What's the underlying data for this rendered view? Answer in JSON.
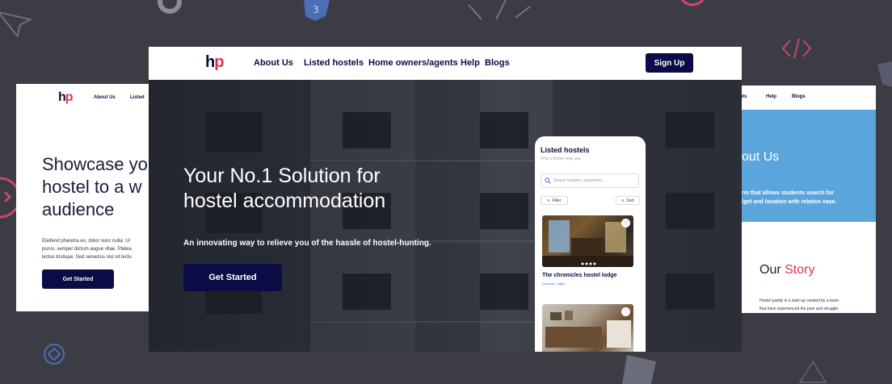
{
  "brand": {
    "logo_h": "h",
    "logo_p": "p"
  },
  "colors": {
    "navy": "#0b0b45",
    "red": "#e2304b",
    "blue_band": "#5aa6dc",
    "background": "#3c3c45"
  },
  "main": {
    "nav": {
      "links": [
        "About Us",
        "Listed hostels",
        "Home owners/agents",
        "Help",
        "Blogs"
      ],
      "signup": "Sign Up"
    },
    "hero": {
      "title_line1": "Your No.1 Solution for",
      "title_line2": "hostel accommodation",
      "subtitle": "An innovating way to relieve you of the hassle of hostel-hunting.",
      "cta": "Get Started"
    },
    "phone": {
      "title": "Listed hostels",
      "subtitle": "Find a hostel near you",
      "search_placeholder": "Search location, apartment...",
      "filter": "Filter",
      "sort": "Sort",
      "card_title": "The chronicles hostel lodge",
      "card_location": "Surulere, Lagos"
    }
  },
  "left_card": {
    "nav": [
      "About Us",
      "Listed"
    ],
    "title_line1": "Showcase yo",
    "title_line2": "hostel to a w",
    "title_line3": "audience",
    "body_line1": "Eleifend pharetra eu, dolor nunc nulla. Ur",
    "body_line2": "purus, semper dictum augue vitae. Platea",
    "body_line3": "lectus tristique. Sed senectus nisl sit lectu",
    "cta": "Get Started"
  },
  "right_card": {
    "nav": [
      "ents",
      "Help",
      "Blogs"
    ],
    "heading": "out Us",
    "desc_line1": "rm that allows students search for",
    "desc_line2": "lget and location with relative ease.",
    "story_plain": "Our ",
    "story_red": "Story",
    "body_line1": "Hostel paddy is a start-up created by a team",
    "body_line2": "that have experienced the pain and struggle"
  }
}
